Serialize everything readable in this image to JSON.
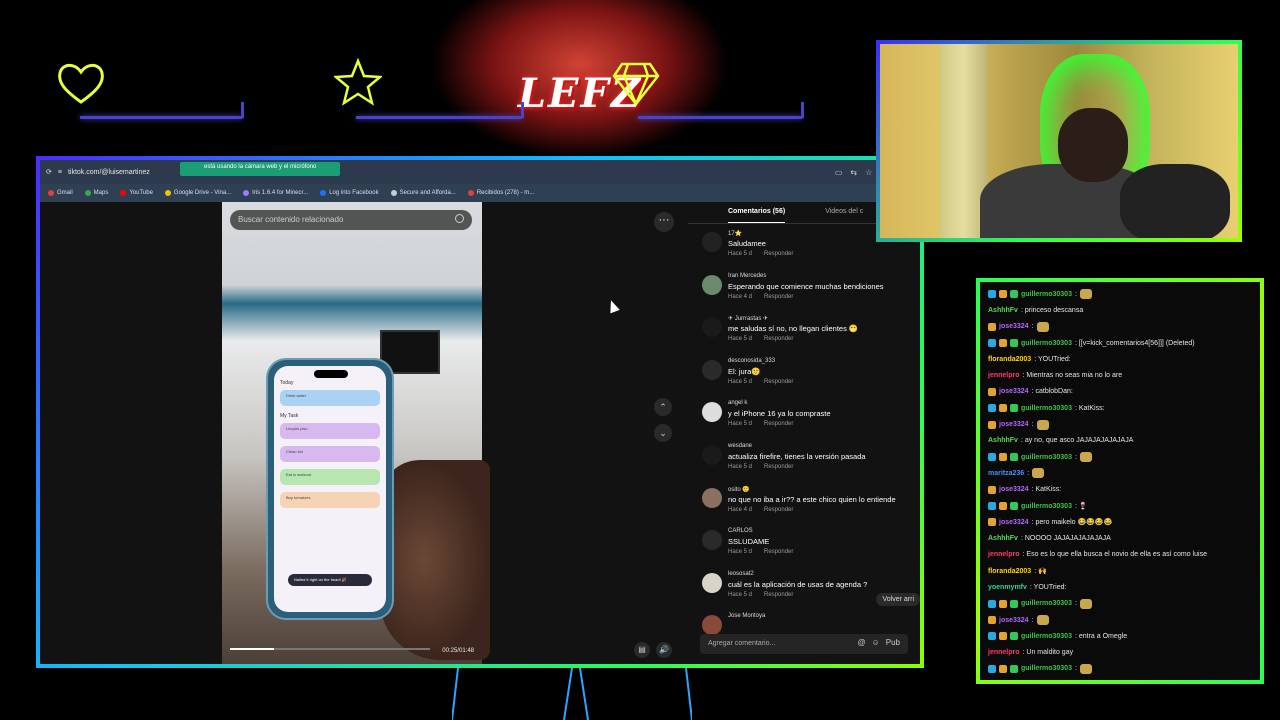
{
  "browser": {
    "url": "tiktok.com/@luisemartinez",
    "camera_notice": "está usando la cámara web y el micrófono",
    "bookmarks": [
      {
        "label": "Gmail",
        "color": "#e34133"
      },
      {
        "label": "Maps",
        "color": "#34a853"
      },
      {
        "label": "YouTube",
        "color": "#ff0000"
      },
      {
        "label": "Google Drive - Vina...",
        "color": "#fbbc04"
      },
      {
        "label": "Iris 1.6.4 for Minecr...",
        "color": "#9d7cff"
      },
      {
        "label": "Log into Facebook",
        "color": "#1877f2"
      },
      {
        "label": "Secure and Afforda...",
        "color": "#cccccc"
      },
      {
        "label": "Recibidos (278) - m...",
        "color": "#e34133"
      }
    ]
  },
  "video": {
    "search_placeholder": "Buscar contenido relacionado",
    "time": "00:25/01:48",
    "progress": 0.22,
    "phone_header": "Today",
    "phone_section": "My Task",
    "phone_toast": "Nailed it right on the head! 🎉",
    "phone_rows": [
      {
        "label": "Drink water",
        "color": "#a9d2f5"
      },
      {
        "label": "Limpiar piso",
        "color": "#d7b8f0"
      },
      {
        "label": "Clean fun",
        "color": "#d7b8f0"
      },
      {
        "label": "Eat is workout",
        "color": "#b8e6b0"
      },
      {
        "label": "Buy tomatoes",
        "color": "#f7d3b5"
      }
    ]
  },
  "comments": {
    "tab_active": "Comentarios (56)",
    "tab_inactive": "Videos del c",
    "reply_label": "Responder",
    "items": [
      {
        "user": "17⭐",
        "text": "Saludamee",
        "time": "Hace 5 d",
        "avatar": "#222"
      },
      {
        "user": "Iran Mercedes",
        "text": "Esperando que comience muchas bendiciones",
        "time": "Hace 4 d",
        "avatar": "#6b8a6b"
      },
      {
        "user": "✈ Jurrrastas ✈",
        "text": "me saludas sí no, no llegan clientes 😁",
        "time": "Hace 5 d",
        "avatar": "#1a1a1a"
      },
      {
        "user": "desconosida_333",
        "text": "El: jura🙂",
        "time": "Hace 5 d",
        "avatar": "#2a2a2a"
      },
      {
        "user": "angel k",
        "text": "y el iPhone 16 ya lo compraste",
        "time": "Hace 5 d",
        "avatar": "#dddddd"
      },
      {
        "user": "wesdane",
        "text": "actualiza firefire, tienes la versión pasada",
        "time": "Hace 5 d",
        "avatar": "#1a1a1a"
      },
      {
        "user": "osito 🙂",
        "text": "no que no iba a ir?? a este chico quien lo entiende",
        "time": "Hace 4 d",
        "avatar": "#8a7060"
      },
      {
        "user": "CARLOS",
        "text": "SSLUDAME",
        "time": "Hace 5 d",
        "avatar": "#2a2a2a"
      },
      {
        "user": "leososat2",
        "text": "cuál es la aplicación de usas de agenda ?",
        "time": "Hace 5 d",
        "avatar": "#d8d5c8"
      },
      {
        "user": "Jose Montoya",
        "text": "",
        "time": "",
        "avatar": "#8a4a3a"
      }
    ],
    "add_placeholder": "Agregar comentario...",
    "post_label": "Pub",
    "scroll_top_label": "Volver arri"
  },
  "chat": {
    "messages": [
      {
        "badges": [
          "blue",
          "gold",
          "green"
        ],
        "user": "guillermo30303",
        "user_color": "#3ec24a",
        "text": ":",
        "emote": true
      },
      {
        "badges": [],
        "user": "AshhhFv",
        "user_color": "#5ad65a",
        "text": ": princeso descansa",
        "emote": false
      },
      {
        "badges": [
          "gold"
        ],
        "user": "jose3324",
        "user_color": "#b567ff",
        "text": ":",
        "emote": true
      },
      {
        "badges": [
          "blue",
          "gold",
          "green"
        ],
        "user": "guillermo30303",
        "user_color": "#3ec24a",
        "text": ": [[v=kick_comentarios4[56]]] (Deleted)",
        "emote": false
      },
      {
        "badges": [],
        "user": "floranda2003",
        "user_color": "#ffd400",
        "text": ": YOUTried:",
        "emote": false
      },
      {
        "badges": [],
        "user": "jennelpro",
        "user_color": "#ff3b6b",
        "text": ": Mientras no seas mia no lo are",
        "emote": false
      },
      {
        "badges": [
          "gold"
        ],
        "user": "jose3324",
        "user_color": "#b567ff",
        "text": ": catblobDan:",
        "emote": false
      },
      {
        "badges": [
          "blue",
          "gold",
          "green"
        ],
        "user": "guillermo30303",
        "user_color": "#3ec24a",
        "text": ": KatKiss:",
        "emote": false
      },
      {
        "badges": [
          "gold"
        ],
        "user": "jose3324",
        "user_color": "#b567ff",
        "text": ":",
        "emote": true
      },
      {
        "badges": [],
        "user": "AshhhFv",
        "user_color": "#5ad65a",
        "text": ": ay no, que asco JAJAJAJAJAJAJA",
        "emote": false
      },
      {
        "badges": [
          "blue",
          "gold",
          "green"
        ],
        "user": "guillermo30303",
        "user_color": "#3ec24a",
        "text": ":",
        "emote": true
      },
      {
        "badges": [],
        "user": "maritza236",
        "user_color": "#4c8dff",
        "text": ":",
        "emote": true
      },
      {
        "badges": [
          "gold"
        ],
        "user": "jose3324",
        "user_color": "#b567ff",
        "text": ": KatKiss:",
        "emote": false
      },
      {
        "badges": [
          "blue",
          "gold",
          "green"
        ],
        "user": "guillermo30303",
        "user_color": "#3ec24a",
        "text": ": 🍷",
        "emote": false
      },
      {
        "badges": [
          "gold"
        ],
        "user": "jose3324",
        "user_color": "#b567ff",
        "text": ": pero maikelo 😂😂😂😂",
        "emote": false
      },
      {
        "badges": [],
        "user": "AshhhFv",
        "user_color": "#5ad65a",
        "text": ": NOOOO JAJAJAJAJAJAJA",
        "emote": false
      },
      {
        "badges": [],
        "user": "jennelpro",
        "user_color": "#ff3b6b",
        "text": ": Eso es lo que ella busca el novio de ella es así como luise",
        "emote": false
      },
      {
        "badges": [],
        "user": "floranda2003",
        "user_color": "#ffd400",
        "text": ": 🙌",
        "emote": false
      },
      {
        "badges": [],
        "user": "yoenmymfv",
        "user_color": "#2bd3a1",
        "text": ": YOUTried:",
        "emote": false
      },
      {
        "badges": [
          "blue",
          "gold",
          "green"
        ],
        "user": "guillermo30303",
        "user_color": "#3ec24a",
        "text": ":",
        "emote": true
      },
      {
        "badges": [
          "gold"
        ],
        "user": "jose3324",
        "user_color": "#b567ff",
        "text": ":",
        "emote": true
      },
      {
        "badges": [
          "blue",
          "gold",
          "green"
        ],
        "user": "guillermo30303",
        "user_color": "#3ec24a",
        "text": ": entra a Omegle",
        "emote": false
      },
      {
        "badges": [],
        "user": "jennelpro",
        "user_color": "#ff3b6b",
        "text": ": Un maldito gay",
        "emote": false
      },
      {
        "badges": [
          "blue",
          "gold",
          "green"
        ],
        "user": "guillermo30303",
        "user_color": "#3ec24a",
        "text": ":",
        "emote": true
      }
    ]
  },
  "overlay": {
    "logo_text": "LEFZ",
    "accent_line_color": "#4a43c9"
  }
}
